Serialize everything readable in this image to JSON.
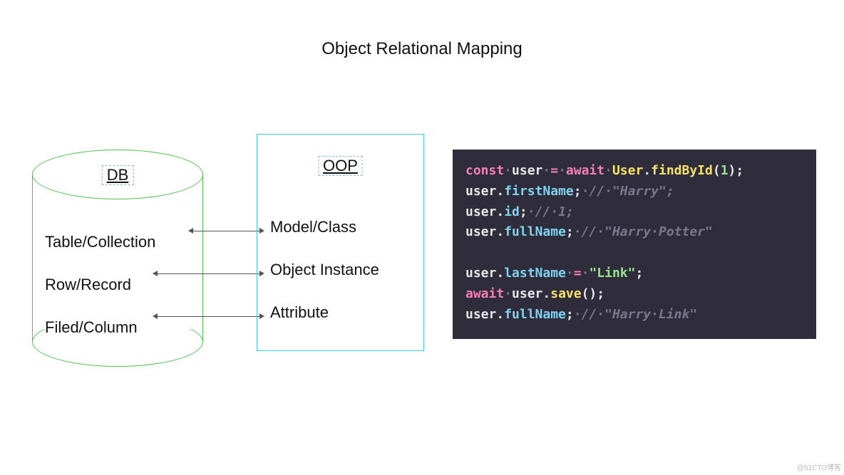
{
  "title": "Object Relational Mapping",
  "db": {
    "label": "DB",
    "items": [
      "Table/Collection",
      "Row/Record",
      "Filed/Column"
    ]
  },
  "oop": {
    "label": "OOP",
    "items": [
      "Model/Class",
      "Object Instance",
      "Attribute"
    ]
  },
  "code": {
    "lines": [
      {
        "t": [
          {
            "c": "kw",
            "v": "const"
          },
          {
            "c": "dot",
            "v": "·"
          },
          {
            "c": "var",
            "v": "user"
          },
          {
            "c": "dot",
            "v": "·"
          },
          {
            "c": "op",
            "v": "="
          },
          {
            "c": "dot",
            "v": "·"
          },
          {
            "c": "kw",
            "v": "await"
          },
          {
            "c": "dot",
            "v": "·"
          },
          {
            "c": "cls",
            "v": "User"
          },
          {
            "c": "var",
            "v": "."
          },
          {
            "c": "fn",
            "v": "findById"
          },
          {
            "c": "paren",
            "v": "("
          },
          {
            "c": "num",
            "v": "1"
          },
          {
            "c": "paren",
            "v": ")"
          },
          {
            "c": "var",
            "v": ";"
          }
        ]
      },
      {
        "t": [
          {
            "c": "var",
            "v": "user"
          },
          {
            "c": "var",
            "v": "."
          },
          {
            "c": "prop",
            "v": "firstName"
          },
          {
            "c": "var",
            "v": ";"
          },
          {
            "c": "dot",
            "v": "·"
          },
          {
            "c": "cmt",
            "v": "//"
          },
          {
            "c": "dot",
            "v": "·"
          },
          {
            "c": "cmt",
            "v": "\"Harry\";"
          }
        ]
      },
      {
        "t": [
          {
            "c": "var",
            "v": "user"
          },
          {
            "c": "var",
            "v": "."
          },
          {
            "c": "prop",
            "v": "id"
          },
          {
            "c": "var",
            "v": ";"
          },
          {
            "c": "dot",
            "v": "·"
          },
          {
            "c": "cmt",
            "v": "//"
          },
          {
            "c": "dot",
            "v": "·"
          },
          {
            "c": "cmt",
            "v": "1;"
          }
        ]
      },
      {
        "t": [
          {
            "c": "var",
            "v": "user"
          },
          {
            "c": "var",
            "v": "."
          },
          {
            "c": "prop",
            "v": "fullName"
          },
          {
            "c": "var",
            "v": ";"
          },
          {
            "c": "dot",
            "v": "·"
          },
          {
            "c": "cmt",
            "v": "//"
          },
          {
            "c": "dot",
            "v": "·"
          },
          {
            "c": "cmt",
            "v": "\"Harry"
          },
          {
            "c": "dot",
            "v": "·"
          },
          {
            "c": "cmt",
            "v": "Potter\""
          }
        ]
      },
      {
        "t": [
          {
            "c": "var",
            "v": ""
          }
        ]
      },
      {
        "t": [
          {
            "c": "var",
            "v": "user"
          },
          {
            "c": "var",
            "v": "."
          },
          {
            "c": "prop",
            "v": "lastName"
          },
          {
            "c": "dot",
            "v": "·"
          },
          {
            "c": "op",
            "v": "="
          },
          {
            "c": "dot",
            "v": "·"
          },
          {
            "c": "str",
            "v": "\"Link\""
          },
          {
            "c": "var",
            "v": ";"
          }
        ]
      },
      {
        "t": [
          {
            "c": "kw",
            "v": "await"
          },
          {
            "c": "dot",
            "v": "·"
          },
          {
            "c": "var",
            "v": "user"
          },
          {
            "c": "var",
            "v": "."
          },
          {
            "c": "fn",
            "v": "save"
          },
          {
            "c": "paren",
            "v": "()"
          },
          {
            "c": "var",
            "v": ";"
          }
        ]
      },
      {
        "t": [
          {
            "c": "var",
            "v": "user"
          },
          {
            "c": "var",
            "v": "."
          },
          {
            "c": "prop",
            "v": "fullName"
          },
          {
            "c": "var",
            "v": ";"
          },
          {
            "c": "dot",
            "v": "·"
          },
          {
            "c": "cmt",
            "v": "//"
          },
          {
            "c": "dot",
            "v": "·"
          },
          {
            "c": "cmt",
            "v": "\"Harry"
          },
          {
            "c": "dot",
            "v": "·"
          },
          {
            "c": "cmt",
            "v": "Link\""
          }
        ]
      }
    ]
  },
  "watermark": "@51CTO博客"
}
